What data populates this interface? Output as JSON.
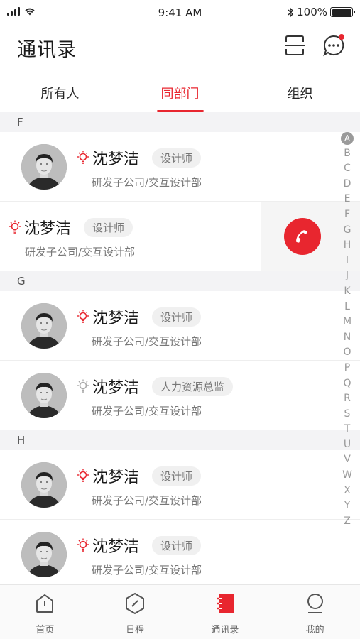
{
  "status_bar": {
    "time": "9:41 AM",
    "battery": "100%"
  },
  "header": {
    "title": "通讯录"
  },
  "tabs": [
    {
      "label": "所有人",
      "active": false
    },
    {
      "label": "同部门",
      "active": true
    },
    {
      "label": "组织",
      "active": false
    }
  ],
  "sections": [
    {
      "letter": "F",
      "contacts": [
        {
          "name": "沈梦洁",
          "role": "设计师",
          "dept": "研发子公司/交互设计部",
          "bulb": "red"
        },
        {
          "name": "沈梦洁",
          "role": "设计师",
          "dept": "研发子公司/交互设计部",
          "bulb": "red",
          "swiped": true
        }
      ]
    },
    {
      "letter": "G",
      "contacts": [
        {
          "name": "沈梦洁",
          "role": "设计师",
          "dept": "研发子公司/交互设计部",
          "bulb": "red"
        },
        {
          "name": "沈梦洁",
          "role": "人力资源总监",
          "dept": "研发子公司/交互设计部",
          "bulb": "gray"
        }
      ]
    },
    {
      "letter": "H",
      "contacts": [
        {
          "name": "沈梦洁",
          "role": "设计师",
          "dept": "研发子公司/交互设计部",
          "bulb": "red"
        },
        {
          "name": "沈梦洁",
          "role": "设计师",
          "dept": "研发子公司/交互设计部",
          "bulb": "red"
        }
      ]
    }
  ],
  "index_letters": [
    "A",
    "B",
    "C",
    "D",
    "E",
    "F",
    "G",
    "H",
    "I",
    "J",
    "K",
    "L",
    "M",
    "N",
    "O",
    "P",
    "Q",
    "R",
    "S",
    "T",
    "U",
    "V",
    "W",
    "X",
    "Y",
    "Z"
  ],
  "index_active": "A",
  "bottom_nav": [
    {
      "label": "首页",
      "icon": "home-icon",
      "active": false
    },
    {
      "label": "日程",
      "icon": "schedule-icon",
      "active": false
    },
    {
      "label": "通讯录",
      "icon": "contacts-icon",
      "active": true
    },
    {
      "label": "我的",
      "icon": "profile-icon",
      "active": false
    }
  ],
  "colors": {
    "accent": "#e8262f",
    "bulb_red": "#e8262f",
    "bulb_gray": "#aaaaaa"
  }
}
